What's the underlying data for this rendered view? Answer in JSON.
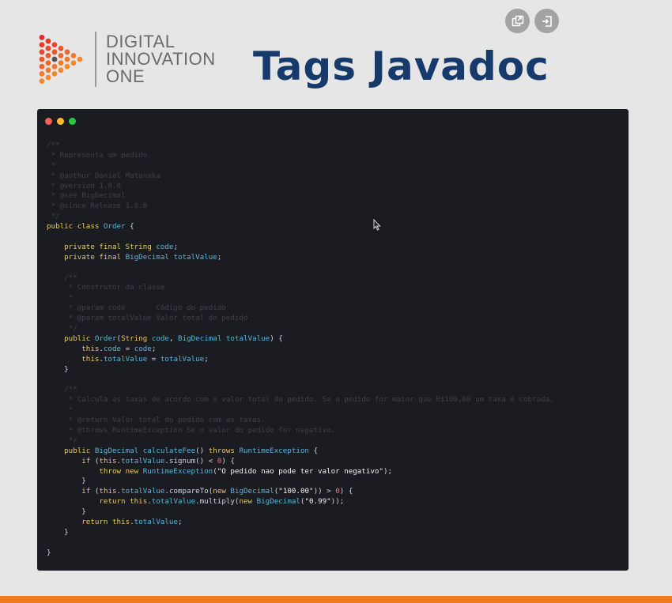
{
  "brand": {
    "lines": [
      "DIGITAL",
      "INNOVATION",
      "ONE"
    ]
  },
  "title": "Tags Javadoc",
  "controls": {
    "items": [
      {
        "icon": "picture-in-picture-icon"
      },
      {
        "icon": "exit-presentation-icon"
      }
    ]
  },
  "colors": {
    "title": "#163a6b",
    "code_background": "#1a1c21",
    "keyword": "#e9c46a",
    "type": "#5fb3d6",
    "comment": "#3c4148",
    "number": "#f07178",
    "accent_bar": "#f07a1e"
  },
  "code": {
    "lines": [
      [
        {
          "t": "/**",
          "c": "cmt"
        }
      ],
      [
        {
          "t": " * Representa um pedido.",
          "c": "cmt"
        }
      ],
      [
        {
          "t": " *",
          "c": "cmt"
        }
      ],
      [
        {
          "t": " * @author Daniel Matanaka",
          "c": "cmt"
        }
      ],
      [
        {
          "t": " * @version 1.0.0",
          "c": "cmt"
        }
      ],
      [
        {
          "t": " * @see BigDecimal",
          "c": "cmt"
        }
      ],
      [
        {
          "t": " * @since Release 1.0.0",
          "c": "cmt"
        }
      ],
      [
        {
          "t": " */",
          "c": "cmt"
        }
      ],
      [
        {
          "t": "public class ",
          "c": "kw"
        },
        {
          "t": "Order",
          "c": "typ"
        },
        {
          "t": " {",
          "c": "txt"
        }
      ],
      [],
      [
        {
          "t": "    private final ",
          "c": "kw"
        },
        {
          "t": "String ",
          "c": "kw"
        },
        {
          "t": "code",
          "c": "typ"
        },
        {
          "t": ";",
          "c": "txt"
        }
      ],
      [
        {
          "t": "    private final ",
          "c": "kw"
        },
        {
          "t": "BigDecimal ",
          "c": "typ"
        },
        {
          "t": "totalValue",
          "c": "typ"
        },
        {
          "t": ";",
          "c": "txt"
        }
      ],
      [],
      [
        {
          "t": "    /**",
          "c": "cmt"
        }
      ],
      [
        {
          "t": "     * Construtor da classe",
          "c": "cmt"
        }
      ],
      [
        {
          "t": "     *",
          "c": "cmt"
        }
      ],
      [
        {
          "t": "     * @param code       Código do pedido",
          "c": "cmt"
        }
      ],
      [
        {
          "t": "     * @param totalValue Valor total do pedido",
          "c": "cmt"
        }
      ],
      [
        {
          "t": "     */",
          "c": "cmt"
        }
      ],
      [
        {
          "t": "    public ",
          "c": "kw"
        },
        {
          "t": "Order",
          "c": "typ"
        },
        {
          "t": "(",
          "c": "txt"
        },
        {
          "t": "String ",
          "c": "kw"
        },
        {
          "t": "code",
          "c": "typ"
        },
        {
          "t": ", ",
          "c": "txt"
        },
        {
          "t": "BigDecimal ",
          "c": "typ"
        },
        {
          "t": "totalValue",
          "c": "typ"
        },
        {
          "t": ") {",
          "c": "txt"
        }
      ],
      [
        {
          "t": "        this",
          "c": "kw"
        },
        {
          "t": ".",
          "c": "txt"
        },
        {
          "t": "code",
          "c": "typ"
        },
        {
          "t": " = ",
          "c": "txt"
        },
        {
          "t": "code",
          "c": "typ"
        },
        {
          "t": ";",
          "c": "txt"
        }
      ],
      [
        {
          "t": "        this",
          "c": "kw"
        },
        {
          "t": ".",
          "c": "txt"
        },
        {
          "t": "totalValue",
          "c": "typ"
        },
        {
          "t": " = ",
          "c": "txt"
        },
        {
          "t": "totalValue",
          "c": "typ"
        },
        {
          "t": ";",
          "c": "txt"
        }
      ],
      [
        {
          "t": "    }",
          "c": "txt"
        }
      ],
      [],
      [
        {
          "t": "    /**",
          "c": "cmt"
        }
      ],
      [
        {
          "t": "     * Calcula as taxas de acordo com o valor total do pedido. Se o pedido for maior que R$100,00 um taxa é cobrada.",
          "c": "cmt"
        }
      ],
      [
        {
          "t": "     *",
          "c": "cmt"
        }
      ],
      [
        {
          "t": "     * @return Valor total do pedido com as taxas.",
          "c": "cmt"
        }
      ],
      [
        {
          "t": "     * @throws RuntimeException Se o valor do pedido for negativo.",
          "c": "cmt"
        }
      ],
      [
        {
          "t": "     */",
          "c": "cmt"
        }
      ],
      [
        {
          "t": "    public ",
          "c": "kw"
        },
        {
          "t": "BigDecimal ",
          "c": "typ"
        },
        {
          "t": "calculateFee",
          "c": "typ"
        },
        {
          "t": "() ",
          "c": "txt"
        },
        {
          "t": "throws ",
          "c": "kw"
        },
        {
          "t": "RuntimeException",
          "c": "typ"
        },
        {
          "t": " {",
          "c": "txt"
        }
      ],
      [
        {
          "t": "        if ",
          "c": "kw"
        },
        {
          "t": "(",
          "c": "txt"
        },
        {
          "t": "this",
          "c": "kw"
        },
        {
          "t": ".",
          "c": "txt"
        },
        {
          "t": "totalValue",
          "c": "typ"
        },
        {
          "t": ".signum() < ",
          "c": "txt"
        },
        {
          "t": "0",
          "c": "num"
        },
        {
          "t": ") {",
          "c": "txt"
        }
      ],
      [
        {
          "t": "            throw new ",
          "c": "kw"
        },
        {
          "t": "RuntimeException",
          "c": "typ"
        },
        {
          "t": "(",
          "c": "txt"
        },
        {
          "t": "\"O pedido nao pode ter valor negativo\"",
          "c": "str"
        },
        {
          "t": ");",
          "c": "txt"
        }
      ],
      [
        {
          "t": "        }",
          "c": "txt"
        }
      ],
      [
        {
          "t": "        if ",
          "c": "kw"
        },
        {
          "t": "(",
          "c": "txt"
        },
        {
          "t": "this",
          "c": "kw"
        },
        {
          "t": ".",
          "c": "txt"
        },
        {
          "t": "totalValue",
          "c": "typ"
        },
        {
          "t": ".compareTo(",
          "c": "txt"
        },
        {
          "t": "new ",
          "c": "kw"
        },
        {
          "t": "BigDecimal",
          "c": "typ"
        },
        {
          "t": "(",
          "c": "txt"
        },
        {
          "t": "\"100.00\"",
          "c": "str"
        },
        {
          "t": ")) > ",
          "c": "txt"
        },
        {
          "t": "0",
          "c": "num"
        },
        {
          "t": ") {",
          "c": "txt"
        }
      ],
      [
        {
          "t": "            return ",
          "c": "kw"
        },
        {
          "t": "this",
          "c": "kw"
        },
        {
          "t": ".",
          "c": "txt"
        },
        {
          "t": "totalValue",
          "c": "typ"
        },
        {
          "t": ".multiply(",
          "c": "txt"
        },
        {
          "t": "new ",
          "c": "kw"
        },
        {
          "t": "BigDecimal",
          "c": "typ"
        },
        {
          "t": "(",
          "c": "txt"
        },
        {
          "t": "\"0.99\"",
          "c": "str"
        },
        {
          "t": "));",
          "c": "txt"
        }
      ],
      [
        {
          "t": "        }",
          "c": "txt"
        }
      ],
      [
        {
          "t": "        return ",
          "c": "kw"
        },
        {
          "t": "this",
          "c": "kw"
        },
        {
          "t": ".",
          "c": "txt"
        },
        {
          "t": "totalValue",
          "c": "typ"
        },
        {
          "t": ";",
          "c": "txt"
        }
      ],
      [
        {
          "t": "    }",
          "c": "txt"
        }
      ],
      [],
      [
        {
          "t": "}",
          "c": "txt"
        }
      ]
    ]
  }
}
